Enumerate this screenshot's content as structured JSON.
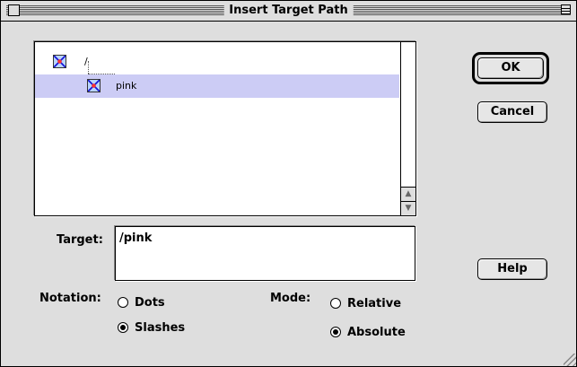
{
  "window": {
    "title": "Insert Target Path"
  },
  "tree": {
    "items": [
      {
        "label": "/",
        "selected": false,
        "level": 0
      },
      {
        "label": "pink",
        "selected": true,
        "level": 1
      }
    ]
  },
  "target": {
    "label": "Target:",
    "value": "/pink"
  },
  "buttons": {
    "ok": "OK",
    "cancel": "Cancel",
    "help": "Help"
  },
  "notation": {
    "label": "Notation:",
    "options": [
      {
        "label": "Dots",
        "checked": false
      },
      {
        "label": "Slashes",
        "checked": true
      }
    ]
  },
  "mode": {
    "label": "Mode:",
    "options": [
      {
        "label": "Relative",
        "checked": false
      },
      {
        "label": "Absolute",
        "checked": true
      }
    ]
  },
  "colors": {
    "selection": "#ccccf5",
    "window_bg": "#dedede"
  }
}
